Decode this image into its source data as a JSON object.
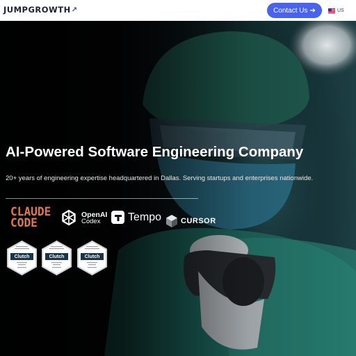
{
  "header": {
    "logo": "JUMPGROWTH",
    "contact_label": "Contact Us",
    "lang_code": "US"
  },
  "hero": {
    "title": "AI-Powered Software Engineering Company",
    "subtitle": "20+ years of engineering expertise headquartered in Dallas. Serving startups and enterprises nationwide.",
    "partners": {
      "claude_line1": "CLAUDE",
      "claude_line2": "CODE",
      "openai_line1": "OpenAI",
      "openai_line2": "Codex",
      "tempo": "Tempo",
      "cursor": "CURSOR"
    },
    "badges": [
      {
        "brand": "Clutch",
        "icon": "clutch-award-badge"
      },
      {
        "brand": "Clutch",
        "icon": "clutch-award-badge"
      },
      {
        "brand": "Clutch",
        "icon": "clutch-award-badge"
      }
    ]
  },
  "colors": {
    "accent": "#4a63ea",
    "claude": "#e2774f",
    "logo_dark": "#1c2236"
  }
}
